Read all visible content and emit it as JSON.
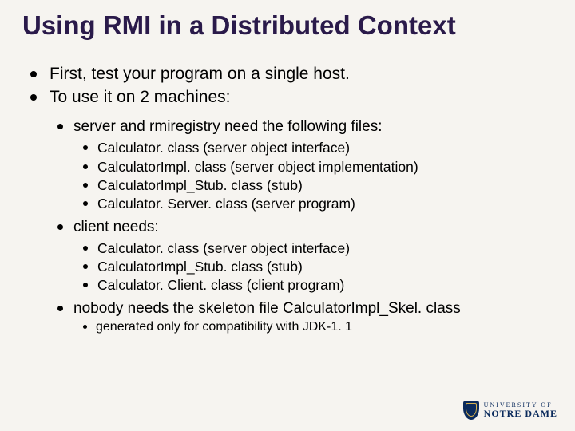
{
  "title": "Using RMI in a Distributed Context",
  "bullets": {
    "b1": "First, test your program on a single host.",
    "b2": "To use it on 2 machines:",
    "b2_1": "server and rmiregistry need the following files:",
    "b2_1_1": "Calculator. class (server object interface)",
    "b2_1_2": "CalculatorImpl. class (server object implementation)",
    "b2_1_3": "CalculatorImpl_Stub. class (stub)",
    "b2_1_4": "Calculator. Server. class (server program)",
    "b2_2": "client needs:",
    "b2_2_1": "Calculator. class (server object interface)",
    "b2_2_2": "CalculatorImpl_Stub. class (stub)",
    "b2_2_3": "Calculator. Client. class (client program)",
    "b2_3": "nobody needs the skeleton file CalculatorImpl_Skel. class",
    "b2_3_1": "generated only for compatibility with JDK-1. 1"
  },
  "logo": {
    "line1": "UNIVERSITY OF",
    "line2": "NOTRE DAME"
  }
}
